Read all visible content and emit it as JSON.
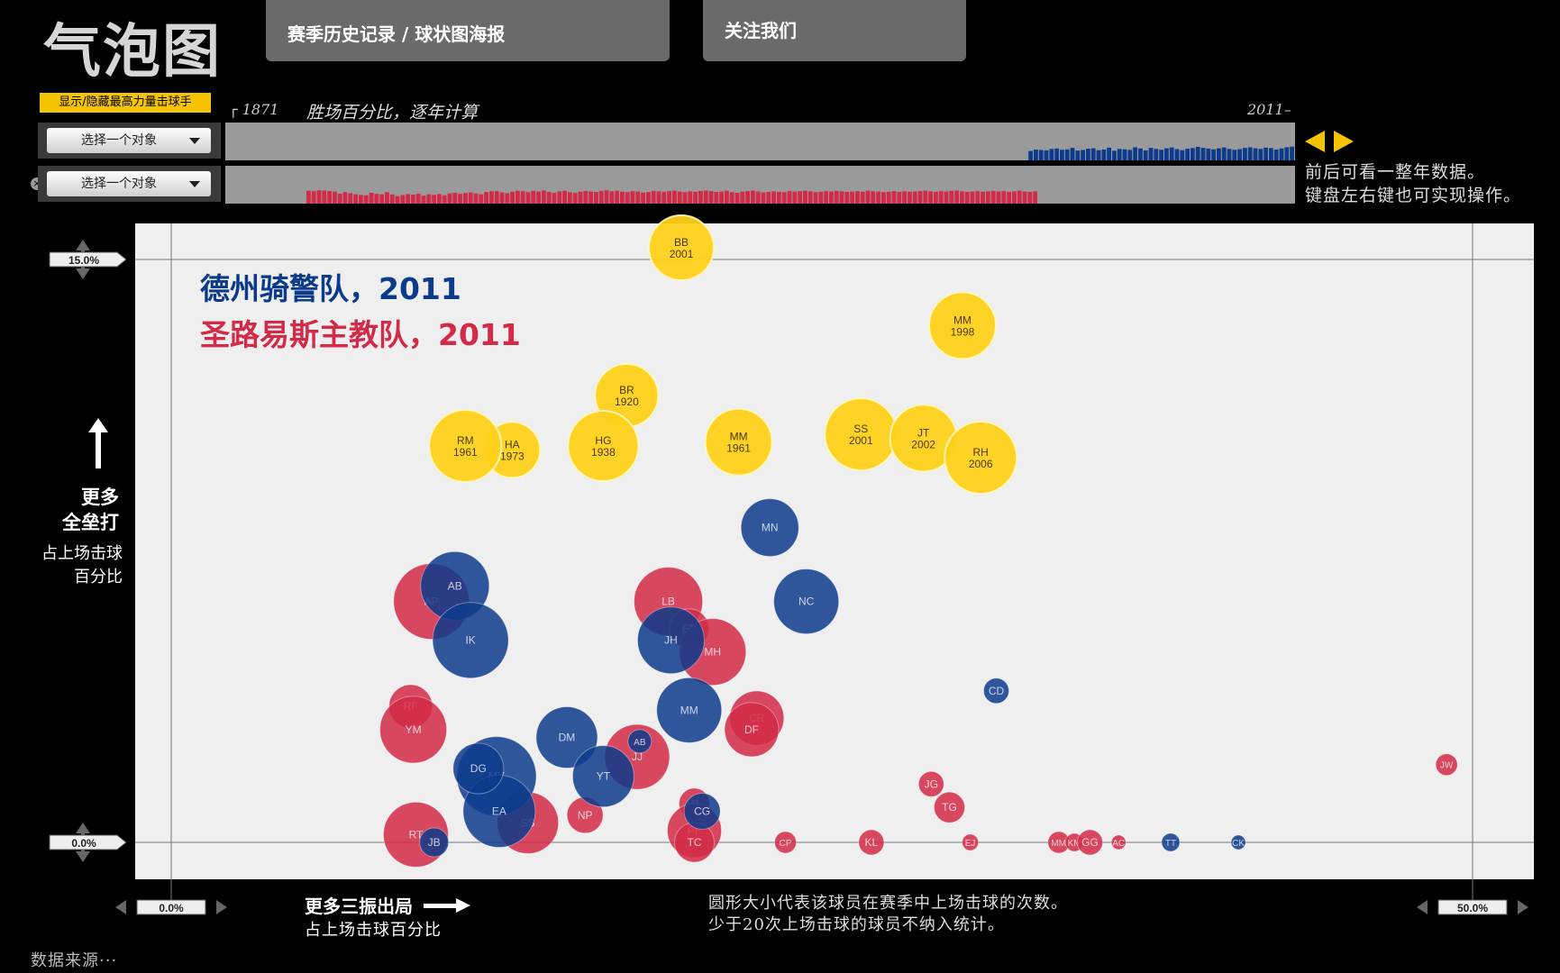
{
  "header": {
    "logo": "气泡图",
    "nav": [
      {
        "label": "赛季历史记录 / 球状图海报"
      },
      {
        "label": "关注我们"
      }
    ]
  },
  "controls": {
    "toggle_label": "显示/隐藏最高力量击球手",
    "selector_1": "选择一个对象",
    "selector_2": "选择一个对象",
    "timeline_start": "┌ 1871",
    "timeline_title": "胜场百分比，逐年计算",
    "timeline_end": "2011–",
    "hint_1": "前后可看一整年数据。",
    "hint_2": "键盘左右键也可实现操作。"
  },
  "colors": {
    "team_1": "#0d3b8c",
    "team_2": "#d22a47",
    "top_hitters": "#ffd11a",
    "strip_bg": "#9a9a9a"
  },
  "footer": {
    "note_1": "圆形大小代表该球员在赛季中上场击球的次数。",
    "note_2": "少于20次上场击球的球员不纳入统计。",
    "source": "数据来源···"
  },
  "chart_data": {
    "type": "scatter",
    "title_lines": [
      "德州骑警队，2011",
      "圣路易斯主教队，2011"
    ],
    "y_axis_label": [
      "更多",
      "全垒打",
      "占上场击球",
      "百分比"
    ],
    "x_axis_label": [
      "更多三振出局",
      "占上场击球百分比"
    ],
    "xlim": [
      0,
      50
    ],
    "ylim": [
      0,
      15
    ],
    "x_ticks": [
      "0.0%",
      "50.0%"
    ],
    "y_ticks": [
      "0.0%",
      "15.0%"
    ],
    "series": [
      {
        "name": "德州骑警队，2011",
        "color": "#0d3b8c",
        "points": [
          {
            "label": "MN",
            "x": 23.0,
            "y": 8.1,
            "r": 32
          },
          {
            "label": "NC",
            "x": 24.4,
            "y": 6.2,
            "r": 36
          },
          {
            "label": "AB",
            "x": 10.9,
            "y": 6.6,
            "r": 38
          },
          {
            "label": "IK",
            "x": 11.5,
            "y": 5.2,
            "r": 42
          },
          {
            "label": "JH",
            "x": 19.2,
            "y": 5.2,
            "r": 37
          },
          {
            "label": "MM",
            "x": 19.9,
            "y": 3.4,
            "r": 36
          },
          {
            "label": "DM",
            "x": 15.2,
            "y": 2.7,
            "r": 34
          },
          {
            "label": "MY",
            "x": 12.5,
            "y": 1.7,
            "r": 44
          },
          {
            "label": "EA",
            "x": 12.6,
            "y": 0.8,
            "r": 40
          },
          {
            "label": "DG",
            "x": 11.8,
            "y": 1.9,
            "r": 28
          },
          {
            "label": "YT",
            "x": 16.6,
            "y": 1.7,
            "r": 34
          },
          {
            "label": "AB",
            "x": 18.0,
            "y": 2.6,
            "r": 13
          },
          {
            "label": "CG",
            "x": 20.4,
            "y": 0.8,
            "r": 20
          },
          {
            "label": "JB",
            "x": 10.1,
            "y": 0.0,
            "r": 16
          },
          {
            "label": "CD",
            "x": 31.7,
            "y": 3.9,
            "r": 14
          },
          {
            "label": "TT",
            "x": 38.4,
            "y": 0.0,
            "r": 10
          },
          {
            "label": "CK",
            "x": 41.0,
            "y": 0.0,
            "r": 8
          }
        ]
      },
      {
        "name": "圣路易斯主教队，2011",
        "color": "#d22a47",
        "points": [
          {
            "label": "AP",
            "x": 10.0,
            "y": 6.2,
            "r": 42
          },
          {
            "label": "LB",
            "x": 19.1,
            "y": 6.2,
            "r": 38
          },
          {
            "label": "RF",
            "x": 9.2,
            "y": 3.5,
            "r": 24
          },
          {
            "label": "YM",
            "x": 9.3,
            "y": 2.9,
            "r": 37
          },
          {
            "label": "EB",
            "x": 19.9,
            "y": 5.5,
            "r": 22
          },
          {
            "label": "MH",
            "x": 20.8,
            "y": 4.9,
            "r": 37
          },
          {
            "label": "CR",
            "x": 22.5,
            "y": 3.2,
            "r": 30
          },
          {
            "label": "DF",
            "x": 22.3,
            "y": 2.9,
            "r": 30
          },
          {
            "label": "JJ",
            "x": 17.9,
            "y": 2.2,
            "r": 36
          },
          {
            "label": "SS",
            "x": 13.7,
            "y": 0.5,
            "r": 34
          },
          {
            "label": "NP",
            "x": 15.9,
            "y": 0.7,
            "r": 20
          },
          {
            "label": "RT",
            "x": 9.4,
            "y": 0.2,
            "r": 36
          },
          {
            "label": "GL",
            "x": 20.1,
            "y": 1.0,
            "r": 17
          },
          {
            "label": "PF",
            "x": 20.1,
            "y": 0.3,
            "r": 30
          },
          {
            "label": "TC",
            "x": 20.1,
            "y": 0.0,
            "r": 22
          },
          {
            "label": "JG",
            "x": 29.2,
            "y": 1.5,
            "r": 14
          },
          {
            "label": "TG",
            "x": 29.9,
            "y": 0.9,
            "r": 17
          },
          {
            "label": "CP",
            "x": 23.6,
            "y": 0.0,
            "r": 12
          },
          {
            "label": "KL",
            "x": 26.9,
            "y": 0.0,
            "r": 14
          },
          {
            "label": "EJ",
            "x": 30.7,
            "y": 0.0,
            "r": 9
          },
          {
            "label": "MM",
            "x": 34.1,
            "y": 0.0,
            "r": 12
          },
          {
            "label": "KM",
            "x": 34.7,
            "y": 0.0,
            "r": 10
          },
          {
            "label": "GG",
            "x": 35.3,
            "y": 0.0,
            "r": 14
          },
          {
            "label": "AC",
            "x": 36.4,
            "y": 0.0,
            "r": 8
          },
          {
            "label": "JW",
            "x": 49.0,
            "y": 2.0,
            "r": 12
          }
        ]
      },
      {
        "name": "最高力量击球手",
        "color": "#ffd11a",
        "points": [
          {
            "label": "BB",
            "l2": "2001",
            "x": 19.6,
            "y": 15.3,
            "r": 36
          },
          {
            "label": "MM",
            "l2": "1998",
            "x": 30.4,
            "y": 13.3,
            "r": 37
          },
          {
            "label": "BR",
            "l2": "1920",
            "x": 17.5,
            "y": 11.5,
            "r": 35
          },
          {
            "label": "SS",
            "l2": "2001",
            "x": 26.5,
            "y": 10.5,
            "r": 40
          },
          {
            "label": "JT",
            "l2": "2002",
            "x": 28.9,
            "y": 10.4,
            "r": 37
          },
          {
            "label": "RH",
            "l2": "2006",
            "x": 31.1,
            "y": 9.9,
            "r": 40
          },
          {
            "label": "MM",
            "l2": "1961",
            "x": 21.8,
            "y": 10.3,
            "r": 37
          },
          {
            "label": "HG",
            "l2": "1938",
            "x": 16.6,
            "y": 10.2,
            "r": 39
          },
          {
            "label": "HA",
            "l2": "1973",
            "x": 13.1,
            "y": 10.1,
            "r": 31
          },
          {
            "label": "RM",
            "l2": "1961",
            "x": 11.3,
            "y": 10.2,
            "r": 40
          }
        ]
      }
    ],
    "win_pct_team_1": [
      0.45,
      0.52,
      0.5,
      0.48,
      0.55,
      0.57,
      0.51,
      0.53,
      0.6,
      0.47,
      0.5,
      0.56,
      0.58,
      0.49,
      0.52,
      0.61,
      0.46,
      0.55,
      0.53,
      0.5,
      0.63,
      0.57,
      0.48,
      0.6,
      0.55,
      0.51,
      0.58,
      0.62,
      0.54,
      0.49,
      0.56,
      0.59,
      0.65,
      0.6,
      0.57,
      0.53,
      0.58,
      0.62,
      0.55,
      0.51,
      0.54,
      0.6,
      0.63,
      0.58,
      0.55,
      0.61,
      0.59,
      0.52,
      0.57,
      0.63,
      0.66
    ],
    "win_pct_team_2": [
      0.62,
      0.6,
      0.64,
      0.63,
      0.6,
      0.58,
      0.48,
      0.55,
      0.5,
      0.45,
      0.42,
      0.4,
      0.52,
      0.47,
      0.45,
      0.55,
      0.44,
      0.36,
      0.41,
      0.46,
      0.43,
      0.48,
      0.38,
      0.45,
      0.42,
      0.46,
      0.4,
      0.49,
      0.52,
      0.47,
      0.51,
      0.54,
      0.49,
      0.45,
      0.56,
      0.59,
      0.6,
      0.54,
      0.5,
      0.57,
      0.62,
      0.6,
      0.55,
      0.61,
      0.58,
      0.63,
      0.56,
      0.52,
      0.59,
      0.62,
      0.55,
      0.51,
      0.57,
      0.6,
      0.58,
      0.56,
      0.61,
      0.64,
      0.59,
      0.62,
      0.57,
      0.55,
      0.6,
      0.58,
      0.53,
      0.56,
      0.61,
      0.59,
      0.57,
      0.6,
      0.62,
      0.58,
      0.55,
      0.59,
      0.57,
      0.61,
      0.63,
      0.6,
      0.56,
      0.58,
      0.62,
      0.55,
      0.52,
      0.57,
      0.6,
      0.63,
      0.58,
      0.54,
      0.56,
      0.59,
      0.57,
      0.55,
      0.61,
      0.58,
      0.6,
      0.62,
      0.59,
      0.55,
      0.57,
      0.6,
      0.58,
      0.61,
      0.59,
      0.56,
      0.58,
      0.6,
      0.57,
      0.62,
      0.59,
      0.58,
      0.55,
      0.57,
      0.6,
      0.56,
      0.59,
      0.57,
      0.58,
      0.6,
      0.62,
      0.59,
      0.57,
      0.6,
      0.58,
      0.61,
      0.63,
      0.59,
      0.56,
      0.58,
      0.6,
      0.57,
      0.59,
      0.61,
      0.58,
      0.6,
      0.57,
      0.59,
      0.62,
      0.58,
      0.56,
      0.59
    ]
  }
}
